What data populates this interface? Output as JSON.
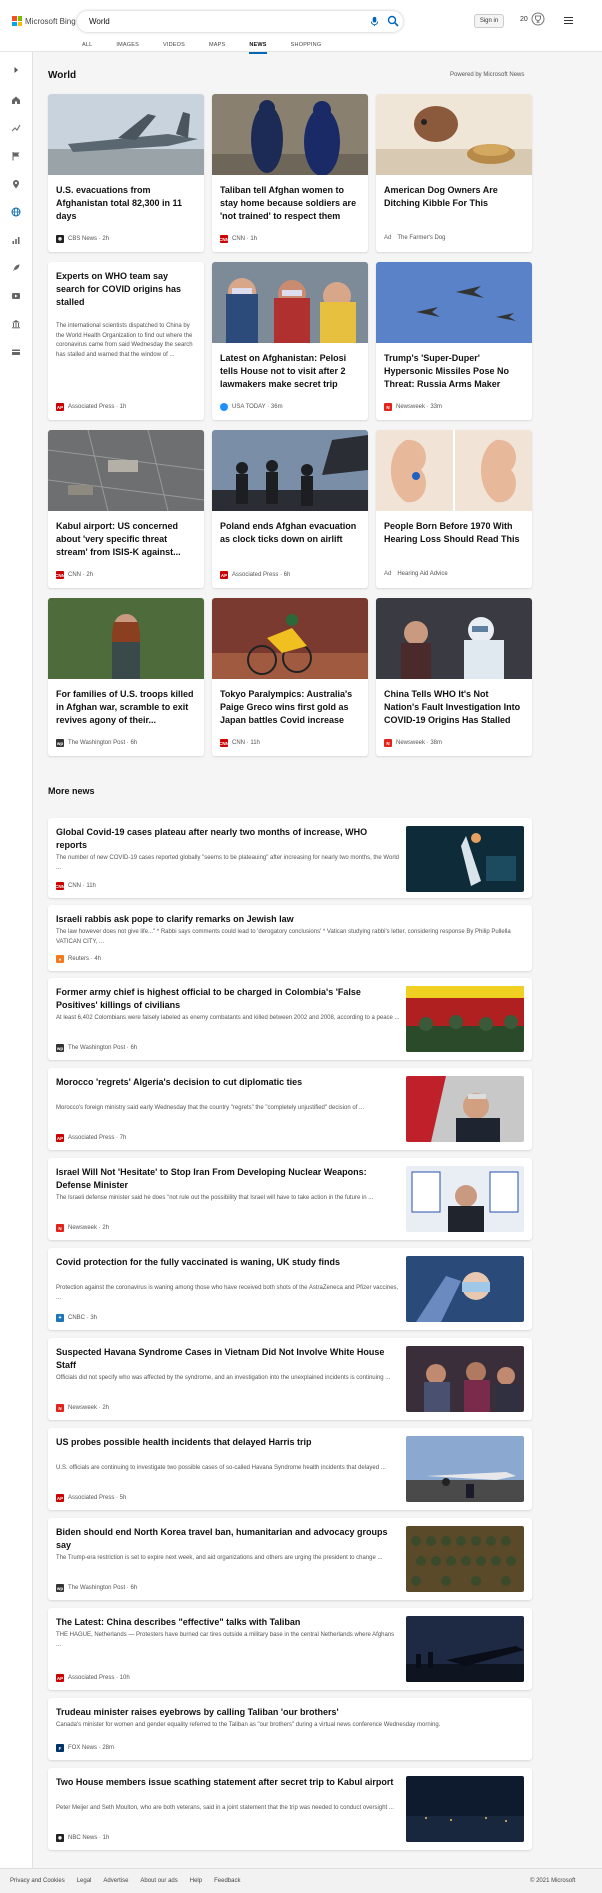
{
  "header": {
    "brand": "Microsoft Bing",
    "search_value": "World",
    "sign_in": "Sign in",
    "points": "20",
    "tabs": [
      "ALL",
      "IMAGES",
      "VIDEOS",
      "MAPS",
      "NEWS",
      "SHOPPING"
    ],
    "active_tab": "NEWS"
  },
  "section": {
    "title": "World",
    "powered_by": "Powered by Microsoft News"
  },
  "cards": [
    {
      "title": "U.S. evacuations from Afghanistan total 82,300 in 11 days",
      "source": "CBS News",
      "age": "2h",
      "logo_color": "#222",
      "logo_text": "◉"
    },
    {
      "title": "Taliban tell Afghan women to stay home because soldiers are 'not trained' to respect them",
      "source": "CNN",
      "age": "1h",
      "logo_color": "#cc0000",
      "logo_text": "CNN"
    },
    {
      "title": "American Dog Owners Are Ditching Kibble For This",
      "ad": "Ad",
      "source": "The Farmer's Dog"
    },
    {
      "title": "Experts on WHO team say search for COVID origins has stalled",
      "snippet": "The international scientists dispatched to China by the World Health Organization to find out where the coronavirus came from said Wednesday the search has stalled and warned that the window of ...",
      "source": "Associated Press",
      "age": "1h",
      "logo_color": "#cc0000",
      "logo_text": "AP"
    },
    {
      "title": "Latest on Afghanistan: Pelosi tells House not to visit after 2 lawmakers make secret trip",
      "source": "USA TODAY",
      "age": "36m",
      "logo_color": "#1e90ff",
      "logo_text": ""
    },
    {
      "title": "Trump's 'Super-Duper' Hypersonic Missiles Pose No Threat: Russia Arms Maker",
      "source": "Newsweek",
      "age": "33m",
      "logo_color": "#e2231a",
      "logo_text": "N"
    },
    {
      "title": "Kabul airport: US concerned about 'very specific threat stream' from ISIS-K against...",
      "source": "CNN",
      "age": "2h",
      "logo_color": "#cc0000",
      "logo_text": "CNN"
    },
    {
      "title": "Poland ends Afghan evacuation as clock ticks down on airlift",
      "source": "Associated Press",
      "age": "6h",
      "logo_color": "#cc0000",
      "logo_text": "AP"
    },
    {
      "title": "People Born Before 1970 With Hearing Loss Should Read This",
      "ad": "Ad",
      "source": "Hearing Aid Advice"
    },
    {
      "title": "For families of U.S. troops killed in Afghan war, scramble to exit revives agony of their...",
      "source": "The Washington Post",
      "age": "6h",
      "logo_color": "#333",
      "logo_text": "wp"
    },
    {
      "title": "Tokyo Paralympics: Australia's Paige Greco wins first gold as Japan battles Covid increase",
      "source": "CNN",
      "age": "11h",
      "logo_color": "#cc0000",
      "logo_text": "CNN"
    },
    {
      "title": "China Tells WHO It's Not Nation's Fault Investigation Into COVID-19 Origins Has Stalled",
      "source": "Newsweek",
      "age": "38m",
      "logo_color": "#e2231a",
      "logo_text": "N"
    }
  ],
  "more_news": {
    "title": "More news",
    "items": [
      {
        "title": "Global Covid-19 cases plateau after nearly two months of increase, WHO reports",
        "snippet": "The number of new COVID-19 cases reported globally \"seems to be plateauing\" after increasing for nearly two months, the World ...",
        "source": "CNN",
        "age": "11h",
        "logo_color": "#cc0000",
        "logo_text": "CNN"
      },
      {
        "title": "Israeli rabbis ask pope to clarify remarks on Jewish law",
        "snippet": "The law however does not give life...\" * Rabbi says comments could lead to 'derogatory conclusions' * Vatican studying rabbi's letter, considering response By Philip Pullella VATICAN CITY, ...",
        "source": "Reuters",
        "age": "4h",
        "logo_color": "#f47a20",
        "logo_text": "●"
      },
      {
        "title": "Former army chief is highest official to be charged in Colombia's 'False Positives' killings of civilians",
        "snippet": "At least 6,402 Colombians were falsely labeled as enemy combatants and killed between 2002 and 2008, according to a peace ...",
        "source": "The Washington Post",
        "age": "6h",
        "logo_color": "#333",
        "logo_text": "wp"
      },
      {
        "title": "Morocco 'regrets' Algeria's decision to cut diplomatic ties",
        "snippet": "Morocco's foreign ministry said early Wednesday that the country \"regrets\" the \"completely unjustified\" decision of ...",
        "source": "Associated Press",
        "age": "7h",
        "logo_color": "#cc0000",
        "logo_text": "AP"
      },
      {
        "title": "Israel Will Not 'Hesitate' to Stop Iran From Developing Nuclear Weapons: Defense Minister",
        "snippet": "The Israeli defense minister said he does \"not rule out the possibility that Israel will have to take action in the future in ...",
        "source": "Newsweek",
        "age": "2h",
        "logo_color": "#e2231a",
        "logo_text": "N"
      },
      {
        "title": "Covid protection for the fully vaccinated is waning, UK study finds",
        "snippet": "Protection against the coronavirus is waning among those who have received both shots of the AstraZeneca and Pfizer vaccines, ...",
        "source": "CNBC",
        "age": "3h",
        "logo_color": "#1b75bb",
        "logo_text": "✦"
      },
      {
        "title": "Suspected Havana Syndrome Cases in Vietnam Did Not Involve White House Staff",
        "snippet": "Officials did not specify who was affected by the syndrome, and an investigation into the unexplained incidents is continuing ...",
        "source": "Newsweek",
        "age": "2h",
        "logo_color": "#e2231a",
        "logo_text": "N"
      },
      {
        "title": "US probes possible health incidents that delayed Harris trip",
        "snippet": "U.S. officials are continuing to investigate two possible cases of so-called Havana Syndrome health incidents that delayed ...",
        "source": "Associated Press",
        "age": "5h",
        "logo_color": "#cc0000",
        "logo_text": "AP"
      },
      {
        "title": "Biden should end North Korea travel ban, humanitarian and advocacy groups say",
        "snippet": "The Trump-era restriction is set to expire next week, and aid organizations and others are urging the president to change ...",
        "source": "The Washington Post",
        "age": "6h",
        "logo_color": "#333",
        "logo_text": "wp"
      },
      {
        "title": "The Latest: China describes \"effective\" talks with Taliban",
        "snippet": "THE HAGUE, Netherlands — Protesters have burned car tires outside a military base in the central Netherlands where Afghans ...",
        "source": "Associated Press",
        "age": "10h",
        "logo_color": "#cc0000",
        "logo_text": "AP"
      },
      {
        "title": "Trudeau minister raises eyebrows by calling Taliban 'our brothers'",
        "snippet": "Canada's minister for women and gender equality referred to the Taliban as \"our brothers\" during a virtual news conference Wednesday morning.",
        "source": "FOX News",
        "age": "28m",
        "logo_color": "#003366",
        "logo_text": "F"
      },
      {
        "title": "Two House members issue scathing statement after secret trip to Kabul airport",
        "snippet": "Peter Meijer and Seth Moulton, who are both veterans, said in a joint statement that the trip was needed to conduct oversight ...",
        "source": "NBC News",
        "age": "1h",
        "logo_color": "#222",
        "logo_text": "◉"
      }
    ]
  },
  "footer": {
    "links": [
      "Privacy and Cookies",
      "Legal",
      "Advertise",
      "About our ads",
      "Help",
      "Feedback"
    ],
    "copyright": "© 2021 Microsoft"
  }
}
